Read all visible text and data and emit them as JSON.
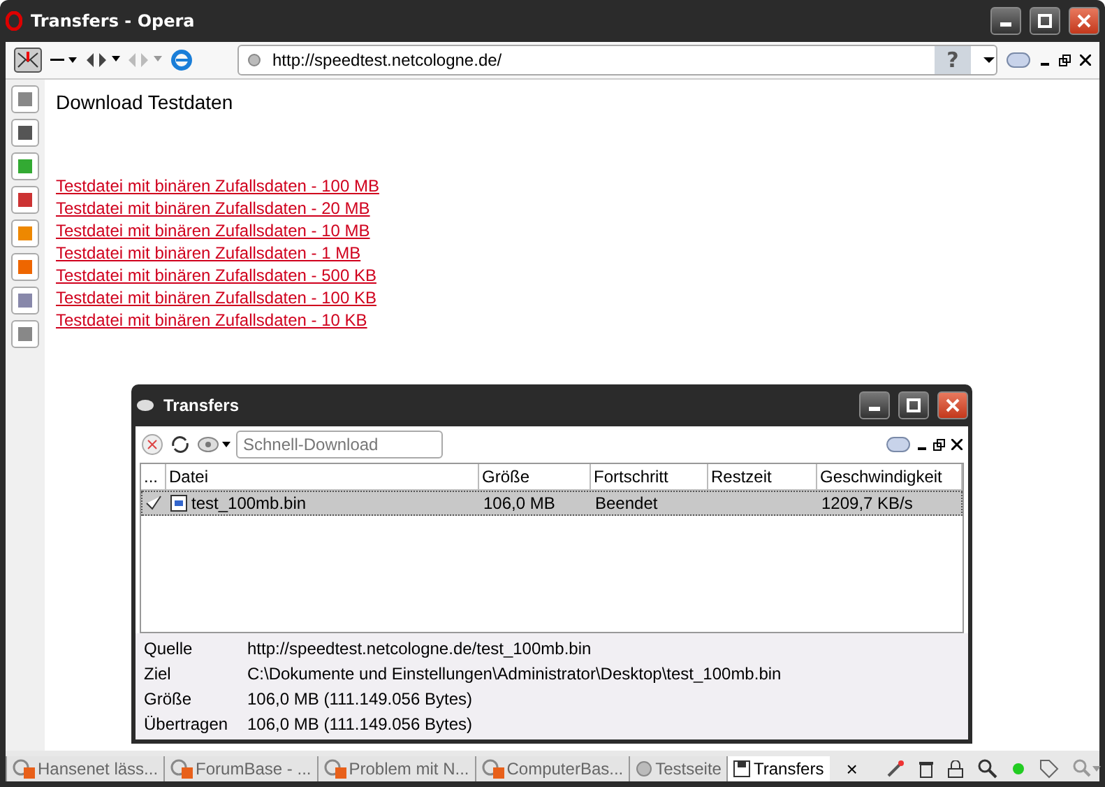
{
  "window": {
    "title": "Transfers - Opera"
  },
  "address": {
    "url": "http://speedtest.netcologne.de/",
    "help": "?"
  },
  "page": {
    "heading": "Download Testdaten",
    "links": [
      "Testdatei mit binären Zufallsdaten - 100 MB",
      "Testdatei mit binären Zufallsdaten - 20 MB",
      "Testdatei mit binären Zufallsdaten - 10 MB",
      "Testdatei mit binären Zufallsdaten - 1 MB",
      "Testdatei mit binären Zufallsdaten - 500 KB",
      "Testdatei mit binären Zufallsdaten - 100 KB",
      "Testdatei mit binären Zufallsdaten - 10 KB"
    ]
  },
  "transfers": {
    "title": "Transfers",
    "quick_download": {
      "placeholder": "Schnell-Download"
    },
    "columns": [
      "...",
      "Datei",
      "Größe",
      "Fortschritt",
      "Restzeit",
      "Geschwindigkeit"
    ],
    "rows": [
      {
        "file": "test_100mb.bin",
        "size": "106,0 MB",
        "progress": "Beendet",
        "remaining": "",
        "speed": "1209,7 KB/s",
        "selected": true,
        "done": true
      }
    ],
    "details": [
      {
        "label": "Quelle",
        "value": "http://speedtest.netcologne.de/test_100mb.bin"
      },
      {
        "label": "Ziel",
        "value": "C:\\Dokumente und Einstellungen\\Administrator\\Desktop\\test_100mb.bin"
      },
      {
        "label": "Größe",
        "value": "106,0 MB (111.149.056 Bytes)"
      },
      {
        "label": "Übertragen",
        "value": "106,0 MB (111.149.056 Bytes)"
      }
    ]
  },
  "tabs": [
    {
      "label": "Hansenet läss...",
      "kind": "forum",
      "selected": false
    },
    {
      "label": "ForumBase - ...",
      "kind": "forum",
      "selected": false
    },
    {
      "label": "Problem mit N...",
      "kind": "forum",
      "selected": false
    },
    {
      "label": "ComputerBas...",
      "kind": "forum",
      "selected": false
    },
    {
      "label": "Testseite",
      "kind": "page",
      "selected": false
    },
    {
      "label": "Transfers",
      "kind": "transfers",
      "selected": true
    }
  ],
  "tab_close": "×"
}
